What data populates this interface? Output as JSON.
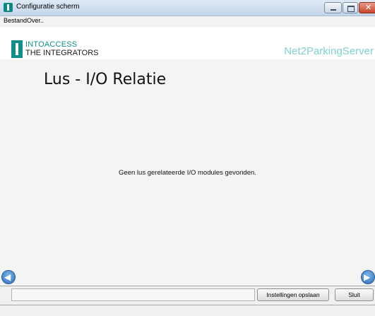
{
  "window": {
    "title": "Configuratie scherm"
  },
  "menu": {
    "items": [
      "Bestand",
      "Over.."
    ]
  },
  "header": {
    "company_line1": "INTOACCESS",
    "company_line2": "THE INTEGRATORS",
    "product": "Net2ParkingServer"
  },
  "page": {
    "title": "Lus - I/O Relatie",
    "message": "Geen lus gerelateerde I/O modules gevonden."
  },
  "footer": {
    "save_label": "Instellingen opslaan",
    "close_label": "Sluit"
  },
  "icons": {
    "back": "arrow-left-icon",
    "next": "arrow-right-icon"
  },
  "colors": {
    "brand_teal": "#0f8f8a",
    "product_text": "#7ed2cf"
  }
}
